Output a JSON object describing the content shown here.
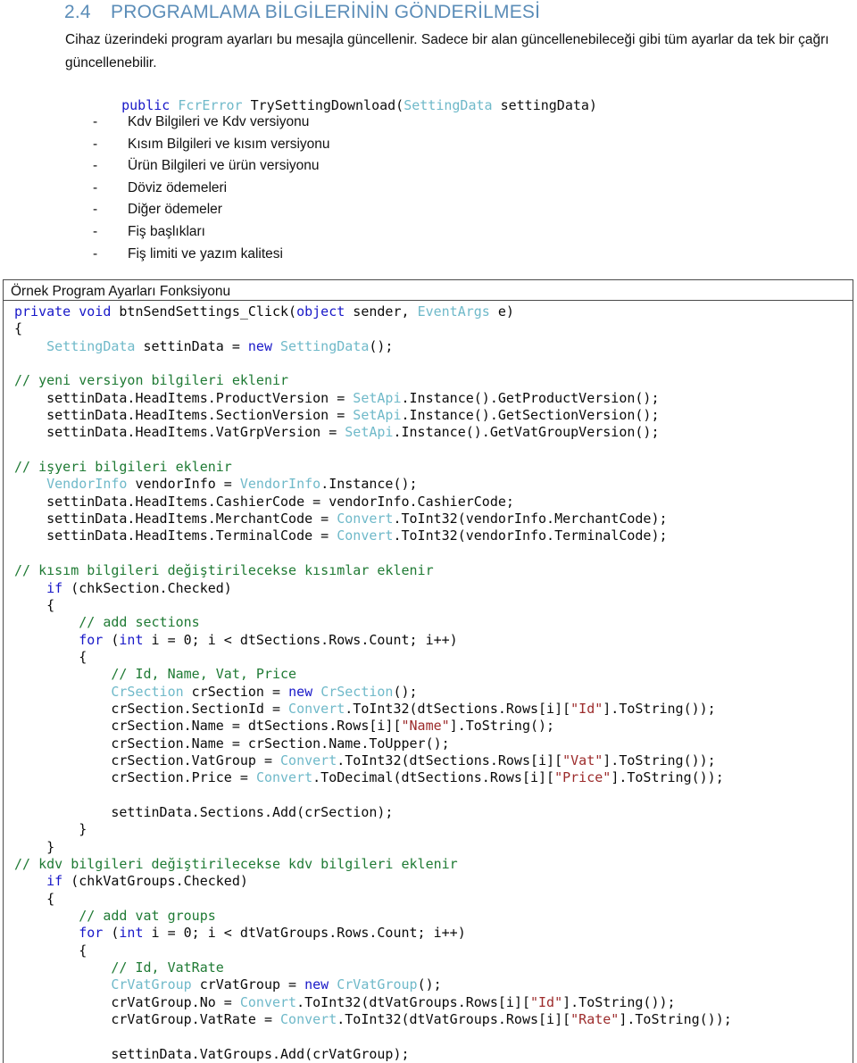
{
  "heading": {
    "number": "2.4",
    "title": "PROGRAMLAMA BİLGİLERİNİN GÖNDERİLMESİ",
    "color": "#5b8db8"
  },
  "paragraph": "Cihaz üzerindeki program ayarları bu mesajla güncellenir. Sadece bir alan güncellenebileceği gibi tüm ayarlar da tek bir çağrı güncellenebilir.",
  "signature": {
    "modifier": "public",
    "return_type": "FcrError",
    "name": " TrySettingDownload(",
    "param_type": "SettingData",
    "param_name": " settingData)"
  },
  "bullets": {
    "dash": "-",
    "items": [
      "Kdv Bilgileri ve Kdv versiyonu",
      "Kısım Bilgileri ve kısım versiyonu",
      "Ürün Bilgileri ve ürün versiyonu",
      "Döviz ödemeleri",
      "Diğer ödemeler",
      "Fiş başlıkları",
      "Fiş limiti ve yazım kalitesi"
    ]
  },
  "code_block": {
    "caption": "Örnek Program Ayarları Fonksiyonu",
    "language": "csharp",
    "colors": {
      "keyword": "#1818c8",
      "type": "#6fb9c9",
      "comment": "#1f7a34",
      "string": "#9c2b2b",
      "text": "#0a0a0a"
    },
    "lines": [
      [
        {
          "t": "private",
          "c": "kw"
        },
        {
          "t": " ",
          "c": ""
        },
        {
          "t": "void",
          "c": "kw"
        },
        {
          "t": " btnSendSettings_Click(",
          "c": ""
        },
        {
          "t": "object",
          "c": "kw"
        },
        {
          "t": " sender, ",
          "c": ""
        },
        {
          "t": "EventArgs",
          "c": "ty"
        },
        {
          "t": " e)",
          "c": ""
        }
      ],
      [
        {
          "t": "{",
          "c": ""
        }
      ],
      [
        {
          "t": "    ",
          "c": ""
        },
        {
          "t": "SettingData",
          "c": "ty"
        },
        {
          "t": " settinData = ",
          "c": ""
        },
        {
          "t": "new",
          "c": "kw"
        },
        {
          "t": " ",
          "c": ""
        },
        {
          "t": "SettingData",
          "c": "ty"
        },
        {
          "t": "();",
          "c": ""
        }
      ],
      [],
      [
        {
          "t": "// yeni versiyon bilgileri eklenir",
          "c": "cm"
        }
      ],
      [
        {
          "t": "    settinData.HeadItems.ProductVersion = ",
          "c": ""
        },
        {
          "t": "SetApi",
          "c": "ty"
        },
        {
          "t": ".Instance().GetProductVersion();",
          "c": ""
        }
      ],
      [
        {
          "t": "    settinData.HeadItems.SectionVersion = ",
          "c": ""
        },
        {
          "t": "SetApi",
          "c": "ty"
        },
        {
          "t": ".Instance().GetSectionVersion();",
          "c": ""
        }
      ],
      [
        {
          "t": "    settinData.HeadItems.VatGrpVersion = ",
          "c": ""
        },
        {
          "t": "SetApi",
          "c": "ty"
        },
        {
          "t": ".Instance().GetVatGroupVersion();",
          "c": ""
        }
      ],
      [],
      [
        {
          "t": "// işyeri bilgileri eklenir",
          "c": "cm"
        }
      ],
      [
        {
          "t": "    ",
          "c": ""
        },
        {
          "t": "VendorInfo",
          "c": "ty"
        },
        {
          "t": " vendorInfo = ",
          "c": ""
        },
        {
          "t": "VendorInfo",
          "c": "ty"
        },
        {
          "t": ".Instance();",
          "c": ""
        }
      ],
      [
        {
          "t": "    settinData.HeadItems.CashierCode = vendorInfo.CashierCode;",
          "c": ""
        }
      ],
      [
        {
          "t": "    settinData.HeadItems.MerchantCode = ",
          "c": ""
        },
        {
          "t": "Convert",
          "c": "ty"
        },
        {
          "t": ".ToInt32(vendorInfo.MerchantCode);",
          "c": ""
        }
      ],
      [
        {
          "t": "    settinData.HeadItems.TerminalCode = ",
          "c": ""
        },
        {
          "t": "Convert",
          "c": "ty"
        },
        {
          "t": ".ToInt32(vendorInfo.TerminalCode);",
          "c": ""
        }
      ],
      [],
      [
        {
          "t": "// kısım bilgileri değiştirilecekse kısımlar eklenir",
          "c": "cm"
        }
      ],
      [
        {
          "t": "    ",
          "c": ""
        },
        {
          "t": "if",
          "c": "kw"
        },
        {
          "t": " (chkSection.Checked)",
          "c": ""
        }
      ],
      [
        {
          "t": "    {",
          "c": ""
        }
      ],
      [
        {
          "t": "        ",
          "c": ""
        },
        {
          "t": "// add sections",
          "c": "cm"
        }
      ],
      [
        {
          "t": "        ",
          "c": ""
        },
        {
          "t": "for",
          "c": "kw"
        },
        {
          "t": " (",
          "c": ""
        },
        {
          "t": "int",
          "c": "kw"
        },
        {
          "t": " i = 0; i < dtSections.Rows.Count; i++)",
          "c": ""
        }
      ],
      [
        {
          "t": "        {",
          "c": ""
        }
      ],
      [
        {
          "t": "            ",
          "c": ""
        },
        {
          "t": "// Id, Name, Vat, Price",
          "c": "cm"
        }
      ],
      [
        {
          "t": "            ",
          "c": ""
        },
        {
          "t": "CrSection",
          "c": "ty"
        },
        {
          "t": " crSection = ",
          "c": ""
        },
        {
          "t": "new",
          "c": "kw"
        },
        {
          "t": " ",
          "c": ""
        },
        {
          "t": "CrSection",
          "c": "ty"
        },
        {
          "t": "();",
          "c": ""
        }
      ],
      [
        {
          "t": "            crSection.SectionId = ",
          "c": ""
        },
        {
          "t": "Convert",
          "c": "ty"
        },
        {
          "t": ".ToInt32(dtSections.Rows[i][",
          "c": ""
        },
        {
          "t": "\"Id\"",
          "c": "st"
        },
        {
          "t": "].ToString());",
          "c": ""
        }
      ],
      [
        {
          "t": "            crSection.Name = dtSections.Rows[i][",
          "c": ""
        },
        {
          "t": "\"Name\"",
          "c": "st"
        },
        {
          "t": "].ToString();",
          "c": ""
        }
      ],
      [
        {
          "t": "            crSection.Name = crSection.Name.ToUpper();",
          "c": ""
        }
      ],
      [
        {
          "t": "            crSection.VatGroup = ",
          "c": ""
        },
        {
          "t": "Convert",
          "c": "ty"
        },
        {
          "t": ".ToInt32(dtSections.Rows[i][",
          "c": ""
        },
        {
          "t": "\"Vat\"",
          "c": "st"
        },
        {
          "t": "].ToString());",
          "c": ""
        }
      ],
      [
        {
          "t": "            crSection.Price = ",
          "c": ""
        },
        {
          "t": "Convert",
          "c": "ty"
        },
        {
          "t": ".ToDecimal(dtSections.Rows[i][",
          "c": ""
        },
        {
          "t": "\"Price\"",
          "c": "st"
        },
        {
          "t": "].ToString());",
          "c": ""
        }
      ],
      [],
      [
        {
          "t": "            settinData.Sections.Add(crSection);",
          "c": ""
        }
      ],
      [
        {
          "t": "        }",
          "c": ""
        }
      ],
      [
        {
          "t": "    }",
          "c": ""
        }
      ],
      [
        {
          "t": "// kdv bilgileri değiştirilecekse kdv bilgileri eklenir",
          "c": "cm"
        }
      ],
      [
        {
          "t": "    ",
          "c": ""
        },
        {
          "t": "if",
          "c": "kw"
        },
        {
          "t": " (chkVatGroups.Checked)",
          "c": ""
        }
      ],
      [
        {
          "t": "    {",
          "c": ""
        }
      ],
      [
        {
          "t": "        ",
          "c": ""
        },
        {
          "t": "// add vat groups",
          "c": "cm"
        }
      ],
      [
        {
          "t": "        ",
          "c": ""
        },
        {
          "t": "for",
          "c": "kw"
        },
        {
          "t": " (",
          "c": ""
        },
        {
          "t": "int",
          "c": "kw"
        },
        {
          "t": " i = 0; i < dtVatGroups.Rows.Count; i++)",
          "c": ""
        }
      ],
      [
        {
          "t": "        {",
          "c": ""
        }
      ],
      [
        {
          "t": "            ",
          "c": ""
        },
        {
          "t": "// Id, VatRate",
          "c": "cm"
        }
      ],
      [
        {
          "t": "            ",
          "c": ""
        },
        {
          "t": "CrVatGroup",
          "c": "ty"
        },
        {
          "t": " crVatGroup = ",
          "c": ""
        },
        {
          "t": "new",
          "c": "kw"
        },
        {
          "t": " ",
          "c": ""
        },
        {
          "t": "CrVatGroup",
          "c": "ty"
        },
        {
          "t": "();",
          "c": ""
        }
      ],
      [
        {
          "t": "            crVatGroup.No = ",
          "c": ""
        },
        {
          "t": "Convert",
          "c": "ty"
        },
        {
          "t": ".ToInt32(dtVatGroups.Rows[i][",
          "c": ""
        },
        {
          "t": "\"Id\"",
          "c": "st"
        },
        {
          "t": "].ToString());",
          "c": ""
        }
      ],
      [
        {
          "t": "            crVatGroup.VatRate = ",
          "c": ""
        },
        {
          "t": "Convert",
          "c": "ty"
        },
        {
          "t": ".ToInt32(dtVatGroups.Rows[i][",
          "c": ""
        },
        {
          "t": "\"Rate\"",
          "c": "st"
        },
        {
          "t": "].ToString());",
          "c": ""
        }
      ],
      [],
      [
        {
          "t": "            settinData.VatGroups.Add(crVatGroup);",
          "c": ""
        }
      ]
    ]
  }
}
